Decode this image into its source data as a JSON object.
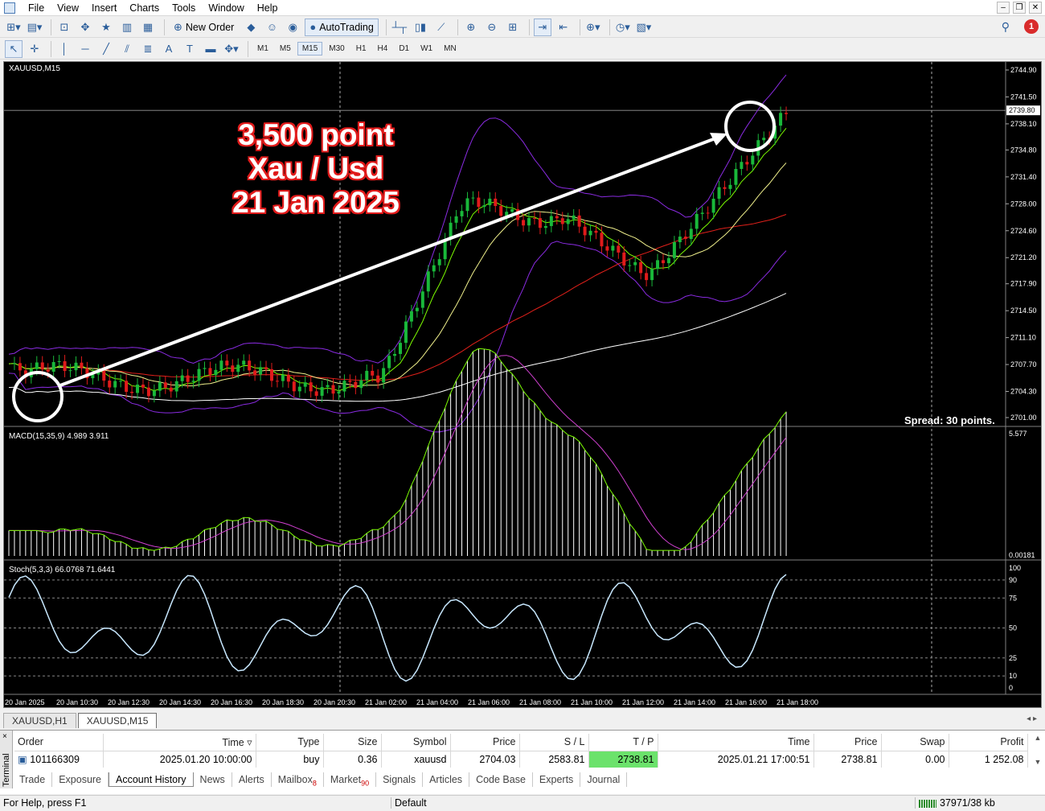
{
  "menu": [
    "File",
    "View",
    "Insert",
    "Charts",
    "Tools",
    "Window",
    "Help"
  ],
  "toolbar": {
    "new_order": "New Order",
    "autotrading": "AutoTrading"
  },
  "timeframes": [
    "M1",
    "M5",
    "M15",
    "M30",
    "H1",
    "H4",
    "D1",
    "W1",
    "MN"
  ],
  "active_timeframe": "M15",
  "notifications": "1",
  "chart": {
    "symbol_title": "XAUUSD,M15",
    "macd_title": "MACD(15,35,9) 4.989 3.911",
    "stoch_title": "Stoch(5,3,3) 66.0768 71.6441",
    "current_price": "2739.80",
    "spread": "Spread: 30 points.",
    "annotation": [
      "3,500 point",
      "Xau / Usd",
      "21 Jan 2025"
    ],
    "price_ticks": [
      "2744.90",
      "2741.50",
      "2738.10",
      "2734.80",
      "2731.40",
      "2728.00",
      "2724.60",
      "2721.20",
      "2717.90",
      "2714.50",
      "2711.10",
      "2707.70",
      "2704.30",
      "2701.00"
    ],
    "macd_ticks": [
      "5.577",
      "0.00181"
    ],
    "stoch_ticks": [
      "100",
      "90",
      "75",
      "50",
      "25",
      "10",
      "0"
    ],
    "time_ticks": [
      "20 Jan 2025",
      "20 Jan 10:30",
      "20 Jan 12:30",
      "20 Jan 14:30",
      "20 Jan 16:30",
      "20 Jan 18:30",
      "20 Jan 20:30",
      "21 Jan 02:00",
      "21 Jan 04:00",
      "21 Jan 06:00",
      "21 Jan 08:00",
      "21 Jan 10:00",
      "21 Jan 12:00",
      "21 Jan 14:00",
      "21 Jan 16:00",
      "21 Jan 18:00"
    ],
    "colors": {
      "bull": "#19b83a",
      "bear": "#e01b1b",
      "bands": "#8a2be2",
      "ma_fast": "#7cfc00",
      "ma_mid": "#f0f08c",
      "ma_slow": "#e0201a",
      "ma_long": "#ffffff",
      "macd_signal": "#d040d0",
      "macd_line": "#7cfc00",
      "stoch": "#c8e8ff"
    }
  },
  "chart_tabs": [
    "XAUUSD,H1",
    "XAUUSD,M15"
  ],
  "active_chart_tab": "XAUUSD,M15",
  "terminal": {
    "label": "Terminal",
    "headers": [
      "Order",
      "Time",
      "Type",
      "Size",
      "Symbol",
      "Price",
      "S / L",
      "T / P",
      "Time",
      "Price",
      "Swap",
      "Profit"
    ],
    "rows": [
      [
        "101166309",
        "2025.01.20 10:00:00",
        "buy",
        "0.36",
        "xauusd",
        "2704.03",
        "2583.81",
        "2738.81",
        "2025.01.21 17:00:51",
        "2738.81",
        "0.00",
        "1 252.08"
      ]
    ],
    "tabs": [
      "Trade",
      "Exposure",
      "Account History",
      "News",
      "Alerts",
      "Mailbox",
      "Market",
      "Signals",
      "Articles",
      "Code Base",
      "Experts",
      "Journal"
    ],
    "active_tab": "Account History",
    "mailbox_count": "8",
    "market_count": "90"
  },
  "status": {
    "help": "For Help, press F1",
    "profile": "Default",
    "traffic": "37971/38 kb"
  }
}
